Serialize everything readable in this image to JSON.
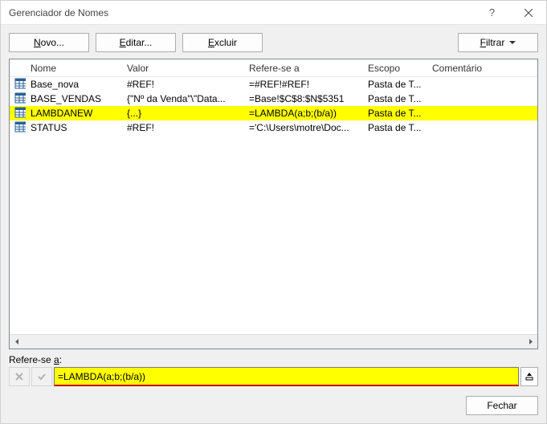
{
  "window": {
    "title": "Gerenciador de Nomes",
    "help": "?",
    "close": "×"
  },
  "toolbar": {
    "new_prefix": "N",
    "new_rest": "ovo...",
    "edit_prefix": "E",
    "edit_rest": "ditar...",
    "delete_prefix": "E",
    "delete_rest": "xcluir",
    "filter_prefix": "F",
    "filter_rest": "iltrar"
  },
  "columns": {
    "name": "Nome",
    "value": "Valor",
    "ref": "Refere-se a",
    "scope": "Escopo",
    "comment": "Comentário"
  },
  "rows": [
    {
      "name": "Base_nova",
      "value": "#REF!",
      "ref": "=#REF!#REF!",
      "scope": "Pasta de T...",
      "comment": "",
      "selected": false
    },
    {
      "name": "BASE_VENDAS",
      "value": "{\"Nº da Venda\"\\\"Data...",
      "ref": "=Base!$C$8:$N$5351",
      "scope": "Pasta de T...",
      "comment": "",
      "selected": false
    },
    {
      "name": "LAMBDANEW",
      "value": "{...}",
      "ref": "=LAMBDA(a;b;(b/a))",
      "scope": "Pasta de T...",
      "comment": "",
      "selected": true
    },
    {
      "name": "STATUS",
      "value": "#REF!",
      "ref": "='C:\\Users\\motre\\Doc...",
      "scope": "Pasta de T...",
      "comment": "",
      "selected": false
    }
  ],
  "referarea": {
    "label_prefix": "Refere-se ",
    "label_ul": "a",
    "label_suffix": ":",
    "value": "=LAMBDA(a;b;(b/a))"
  },
  "footer": {
    "close": "Fechar"
  }
}
